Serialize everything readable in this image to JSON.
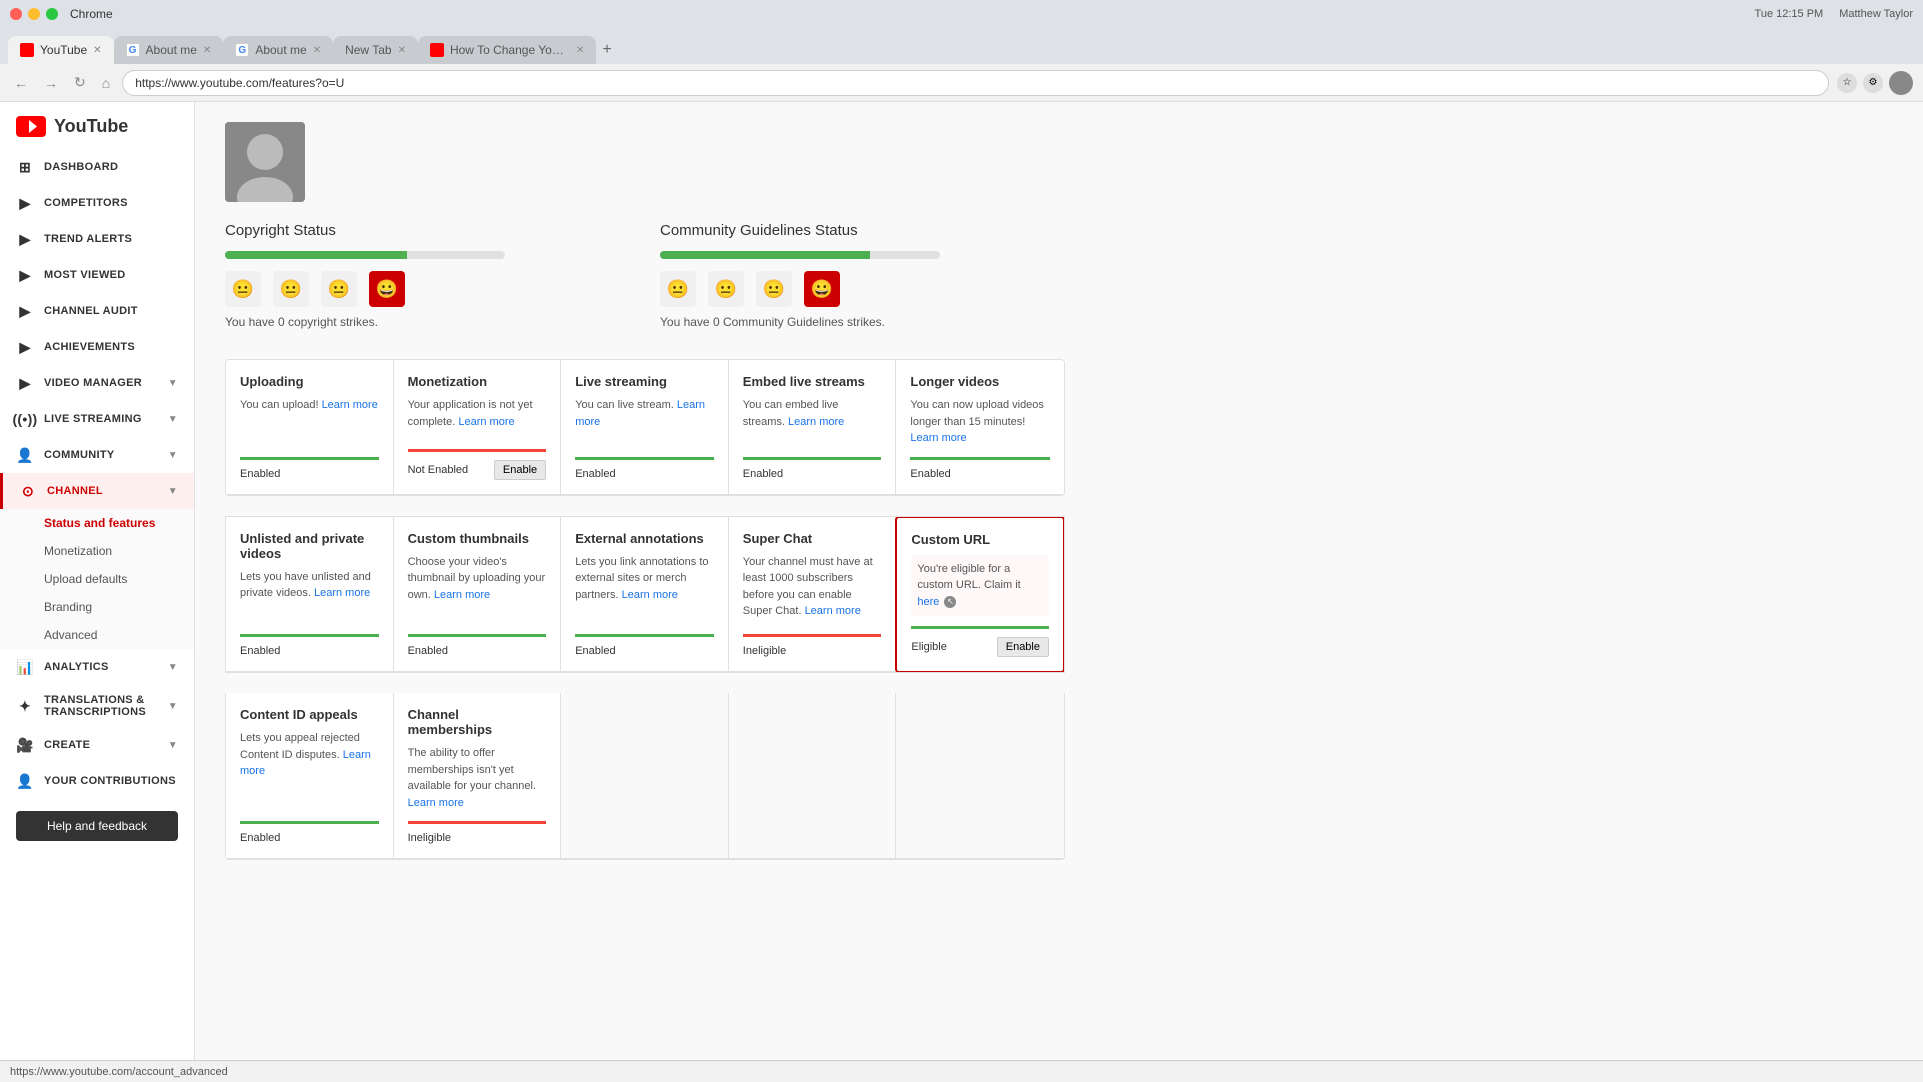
{
  "browser": {
    "brand": "Chrome",
    "tabs": [
      {
        "id": "yt",
        "label": "YouTube",
        "favicon_type": "yt",
        "active": true
      },
      {
        "id": "about1",
        "label": "About me",
        "favicon_type": "g",
        "active": false
      },
      {
        "id": "about2",
        "label": "About me",
        "favicon_type": "g",
        "active": false
      },
      {
        "id": "newtab",
        "label": "New Tab",
        "favicon_type": "plain",
        "active": false
      },
      {
        "id": "howto",
        "label": "How To Change Youtube Chan...",
        "favicon_type": "yt",
        "active": false
      }
    ],
    "url": "https://www.youtube.com/features?o=U",
    "datetime": "Tue 12:15 PM",
    "user": "Matthew Taylor"
  },
  "sidebar": {
    "logo": "YouTube",
    "items": [
      {
        "id": "dashboard",
        "label": "DASHBOARD",
        "icon": "grid"
      },
      {
        "id": "competitors",
        "label": "COMPETITORS",
        "icon": "play"
      },
      {
        "id": "trend-alerts",
        "label": "TREND ALERTS",
        "icon": "play"
      },
      {
        "id": "most-viewed",
        "label": "MOST VIEWED",
        "icon": "play"
      },
      {
        "id": "channel-audit",
        "label": "CHANNEL AUDIT",
        "icon": "play"
      },
      {
        "id": "achievements",
        "label": "ACHIEVEMENTS",
        "icon": "play"
      },
      {
        "id": "video-manager",
        "label": "VIDEO MANAGER",
        "icon": "play",
        "expandable": true
      },
      {
        "id": "live-streaming",
        "label": "LIVE STREAMING",
        "icon": "wifi",
        "expandable": true
      },
      {
        "id": "community",
        "label": "COMMUNITY",
        "icon": "person",
        "expandable": true
      },
      {
        "id": "channel",
        "label": "CHANNEL",
        "icon": "play-circle",
        "active": true,
        "expandable": true
      }
    ],
    "channel_sub": [
      {
        "id": "status-features",
        "label": "Status and features",
        "active": true
      },
      {
        "id": "monetization",
        "label": "Monetization"
      },
      {
        "id": "upload-defaults",
        "label": "Upload defaults"
      },
      {
        "id": "branding",
        "label": "Branding"
      },
      {
        "id": "advanced",
        "label": "Advanced"
      }
    ],
    "more_items": [
      {
        "id": "analytics",
        "label": "ANALYTICS",
        "icon": "bar-chart",
        "expandable": true
      },
      {
        "id": "translations",
        "label": "TRANSLATIONS & TRANSCRIPTIONS",
        "icon": "translate",
        "expandable": true
      },
      {
        "id": "create",
        "label": "CREATE",
        "icon": "video-cam",
        "expandable": true
      },
      {
        "id": "your-contributions",
        "label": "YOUR CONTRIBUTIONS",
        "icon": "person"
      }
    ],
    "help_btn": "Help and feedback"
  },
  "page": {
    "copyright_title": "Copyright Status",
    "copyright_text": "You have 0 copyright strikes.",
    "community_title": "Community Guidelines Status",
    "community_text": "You have 0 Community Guidelines strikes.",
    "features": [
      {
        "title": "Uploading",
        "desc": "You can upload!",
        "desc_link": "Learn more",
        "status": "Enabled",
        "status_type": "enabled"
      },
      {
        "title": "Monetization",
        "desc": "Your application is not yet complete.",
        "desc_link": "Learn more",
        "status": "Not Enabled",
        "status_type": "not-enabled",
        "button": "Enable"
      },
      {
        "title": "Live streaming",
        "desc": "You can live stream.",
        "desc_link": "Learn more",
        "status": "Enabled",
        "status_type": "enabled"
      },
      {
        "title": "Embed live streams",
        "desc": "You can embed live streams.",
        "desc_link": "Learn more",
        "status": "Enabled",
        "status_type": "enabled"
      },
      {
        "title": "Longer videos",
        "desc": "You can now upload videos longer than 15 minutes!",
        "desc_link": "Learn more",
        "status": "Enabled",
        "status_type": "enabled"
      }
    ],
    "features2": [
      {
        "title": "Unlisted and private videos",
        "desc": "Lets you have unlisted and private videos.",
        "desc_link": "Learn more",
        "status": "Enabled",
        "status_type": "enabled"
      },
      {
        "title": "Custom thumbnails",
        "desc": "Choose your video's thumbnail by uploading your own.",
        "desc_link": "Learn more",
        "status": "Enabled",
        "status_type": "enabled"
      },
      {
        "title": "External annotations",
        "desc": "Lets you link annotations to external sites or merch partners.",
        "desc_link": "Learn more",
        "status": "Enabled",
        "status_type": "enabled"
      },
      {
        "title": "Super Chat",
        "desc": "Your channel must have at least 1000 subscribers before you can enable Super Chat.",
        "desc_link": "Learn more",
        "status": "Ineligible",
        "status_type": "ineligible"
      },
      {
        "title": "Custom URL",
        "desc": "You're eligible for a custom URL. Claim it",
        "desc_link": "here",
        "status": "Eligible",
        "status_type": "eligible",
        "button": "Enable",
        "highlight": true
      }
    ],
    "features3": [
      {
        "title": "Content ID appeals",
        "desc": "Lets you appeal rejected Content ID disputes.",
        "desc_link": "Learn more",
        "status": "Enabled",
        "status_type": "enabled"
      },
      {
        "title": "Channel memberships",
        "desc": "The ability to offer memberships isn't yet available for your channel.",
        "desc_link": "Learn more",
        "status": "Ineligible",
        "status_type": "ineligible"
      }
    ]
  },
  "bottom_bar": {
    "url": "https://www.youtube.com/account_advanced"
  }
}
